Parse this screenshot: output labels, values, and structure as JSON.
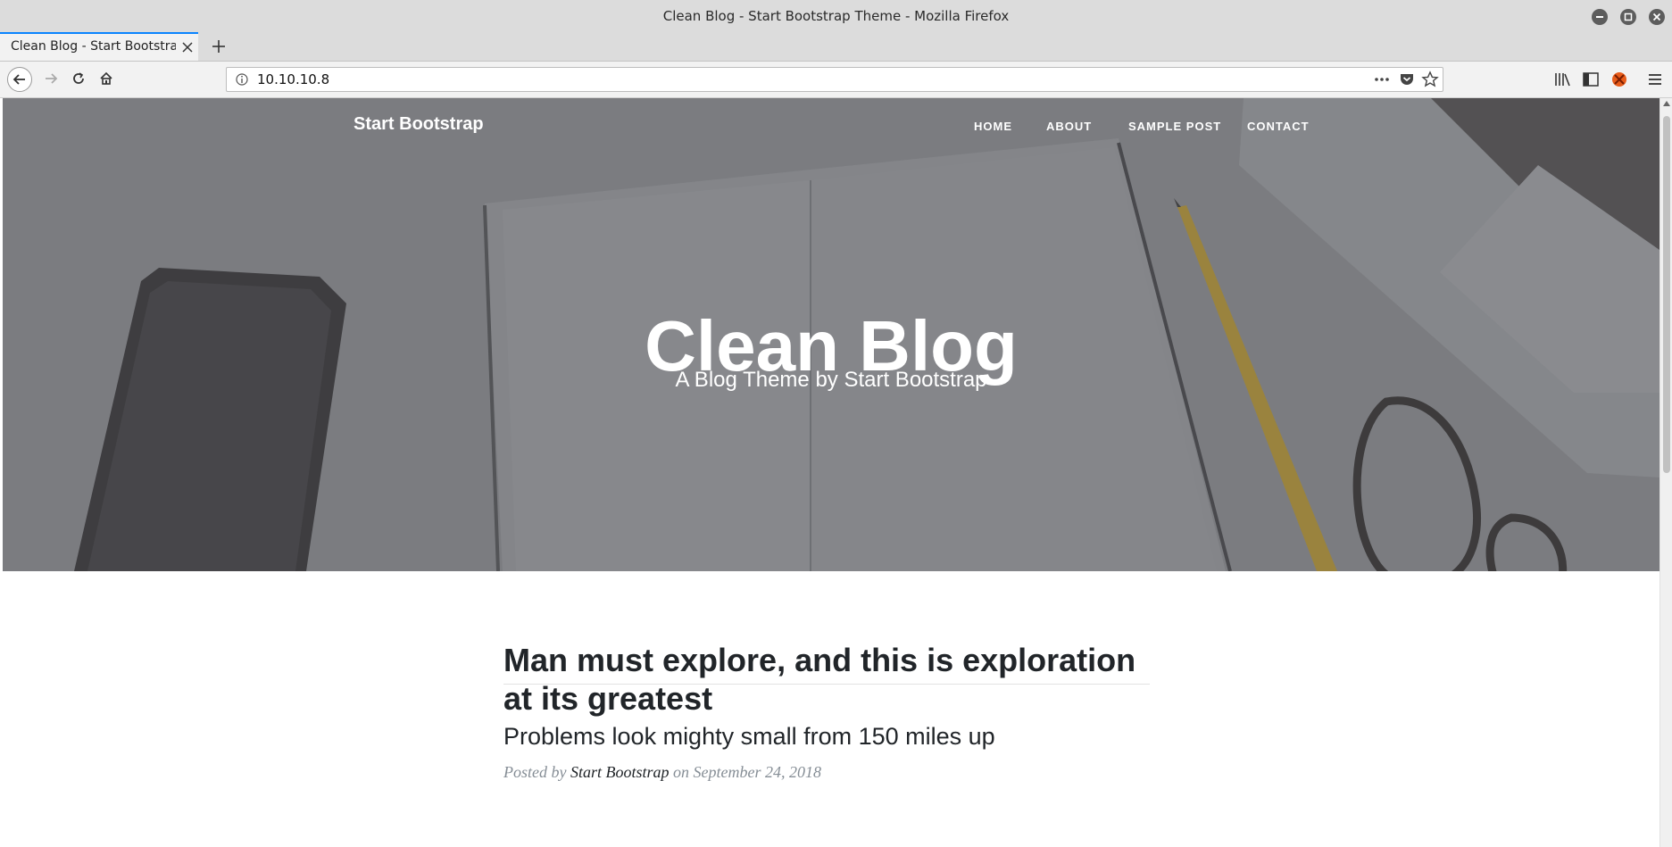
{
  "window": {
    "title": "Clean Blog - Start Bootstrap Theme - Mozilla Firefox"
  },
  "tab": {
    "label": "Clean Blog - Start Bootstrap Theme"
  },
  "urlbar": {
    "url": "10.10.10.8"
  },
  "page": {
    "brand": "Start Bootstrap",
    "nav": [
      "HOME",
      "ABOUT",
      "SAMPLE POST",
      "CONTACT"
    ],
    "hero_title": "Clean Blog",
    "hero_subtitle": "A Blog Theme by Start Bootstrap",
    "post": {
      "title": "Man must explore, and this is exploration at its greatest",
      "subtitle": "Problems look mighty small from 150 miles up",
      "meta_prefix": "Posted by",
      "author": "Start Bootstrap",
      "meta_suffix": "on September 24, 2018"
    }
  },
  "colors": {
    "accent": "#0a84ff",
    "hero_overlay": "#7a7c80",
    "text_dark": "#212529",
    "text_muted": "#868e96"
  }
}
